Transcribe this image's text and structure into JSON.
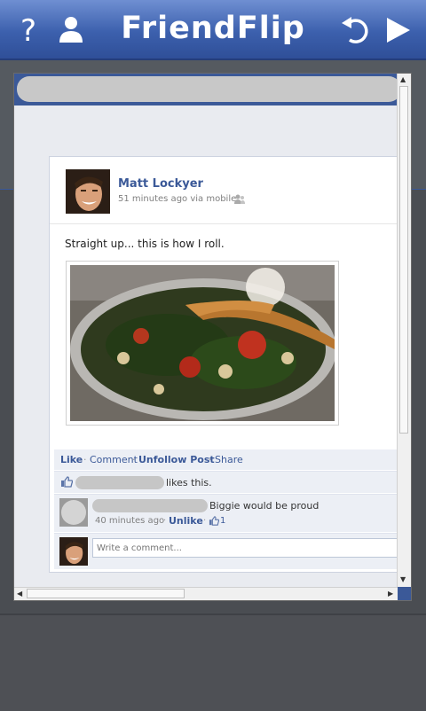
{
  "app": {
    "title": "FriendFlip"
  },
  "toolbar": {
    "help_icon": "question-mark",
    "profile_icon": "person",
    "refresh_icon": "refresh",
    "next_icon": "play"
  },
  "post": {
    "author": "Matt Lockyer",
    "meta": "51 minutes ago via mobile",
    "text": "Straight up... this is how I roll.",
    "actions": {
      "like": "Like",
      "comment": "Comment",
      "unfollow": "Unfollow Post",
      "share": "Share"
    },
    "likes_text": "likes this.",
    "comment": {
      "text": "Biggie would be proud",
      "time": "40 minutes ago",
      "unlike": "Unlike",
      "like_count": "1"
    },
    "write_placeholder": "Write a comment..."
  },
  "colors": {
    "brand": "#3b5998",
    "topbar": "#3c60ad"
  }
}
